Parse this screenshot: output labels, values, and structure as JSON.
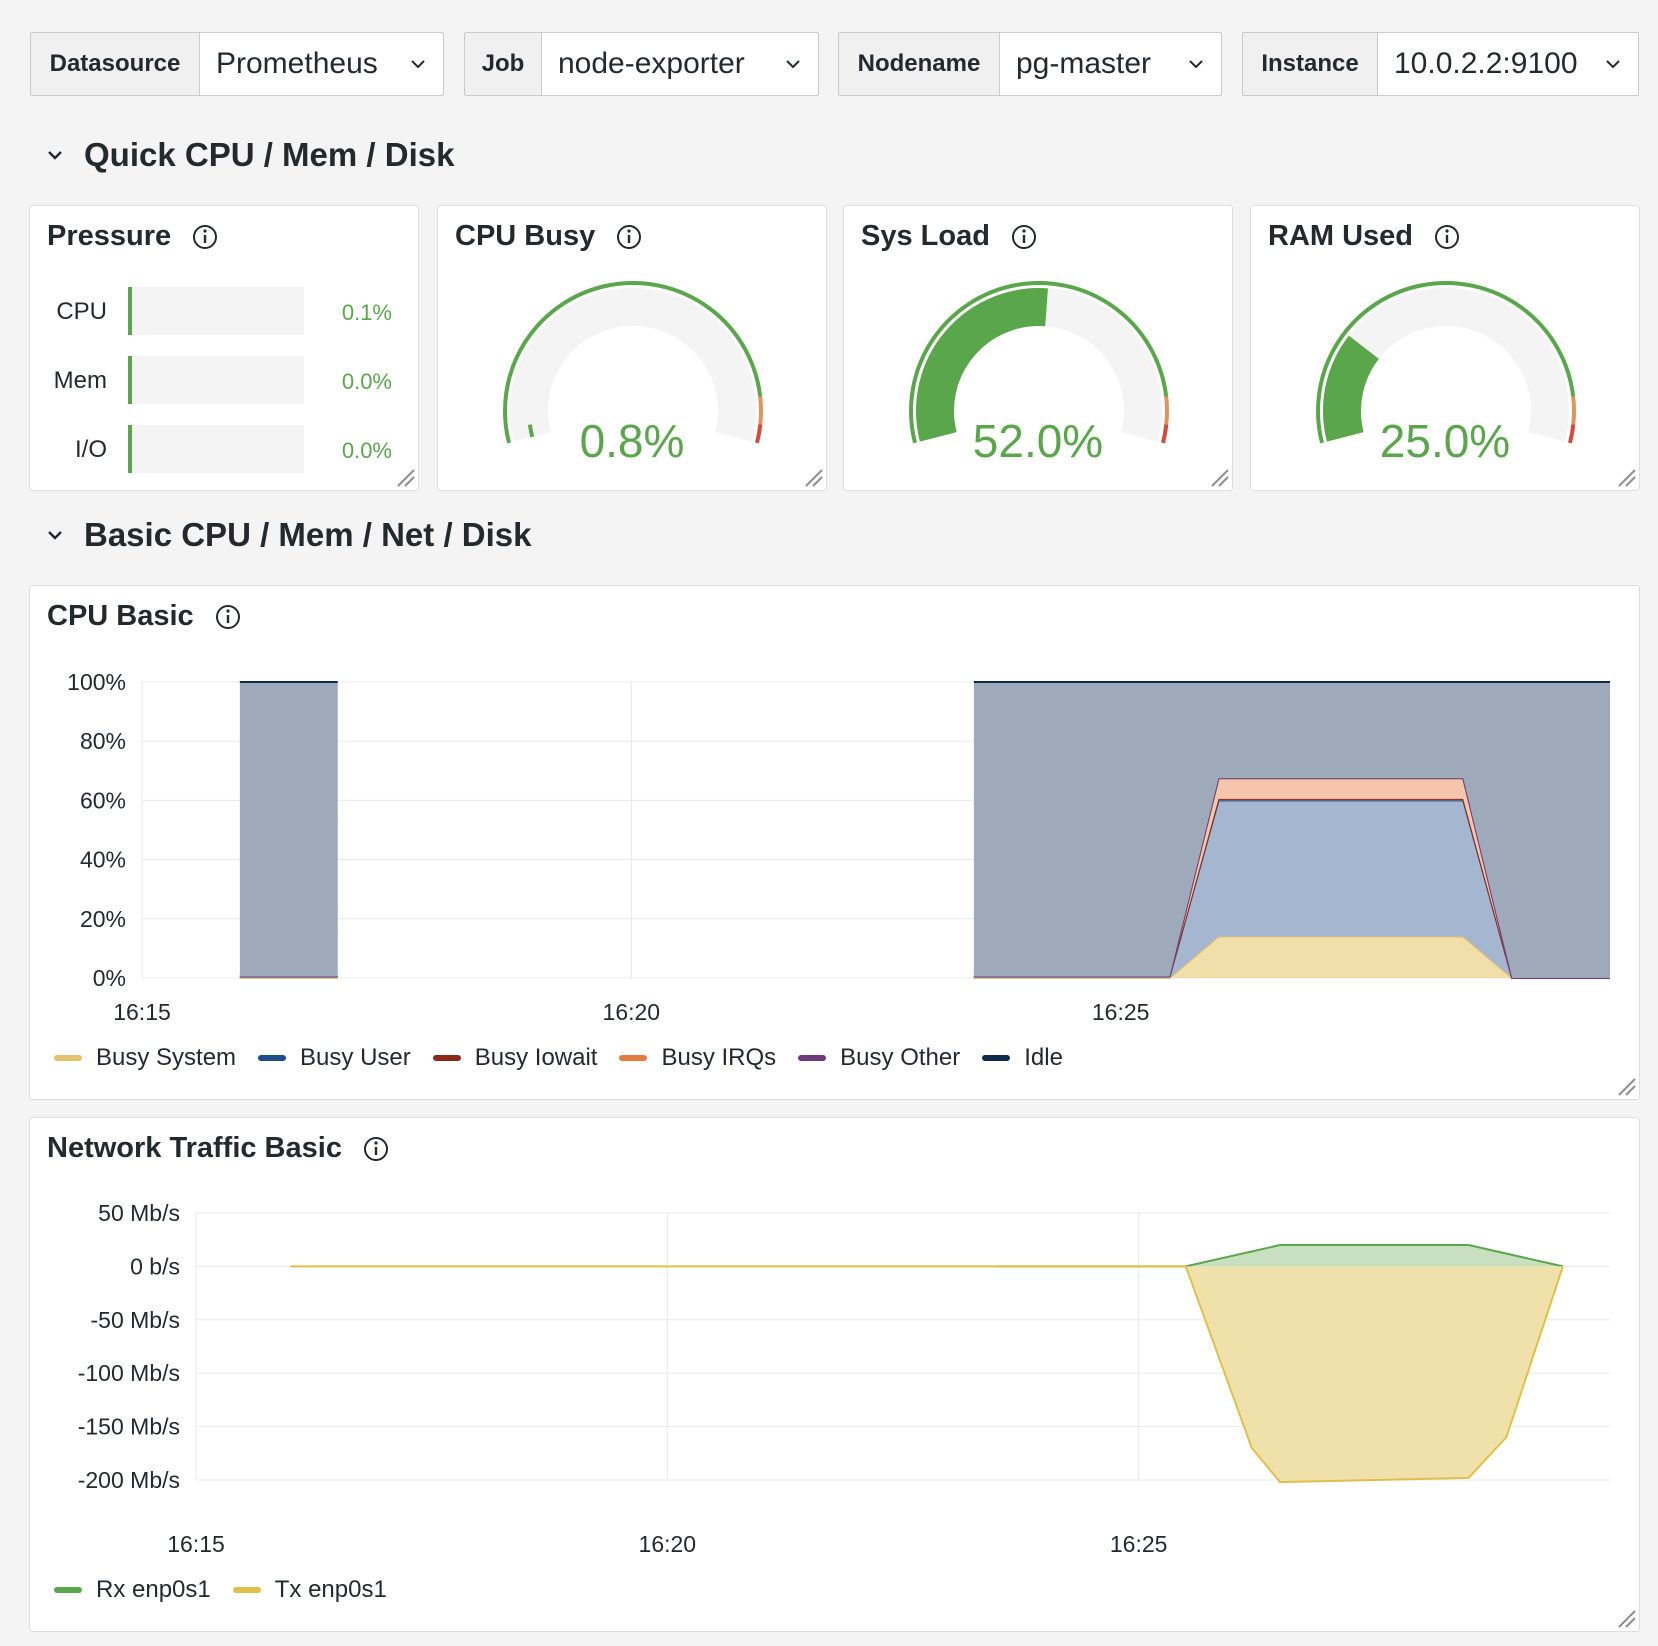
{
  "variables": [
    {
      "label": "Datasource",
      "value": "Prometheus"
    },
    {
      "label": "Job",
      "value": "node-exporter"
    },
    {
      "label": "Nodename",
      "value": "pg-master"
    },
    {
      "label": "Instance",
      "value": "10.0.2.2:9100"
    }
  ],
  "rows": {
    "quick": {
      "title": "Quick CPU / Mem / Disk"
    },
    "basic": {
      "title": "Basic CPU / Mem / Net / Disk"
    }
  },
  "pressure": {
    "title": "Pressure",
    "items": [
      {
        "label": "CPU",
        "value": "0.1%",
        "fraction": 0.001
      },
      {
        "label": "Mem",
        "value": "0.0%",
        "fraction": 0.0
      },
      {
        "label": "I/O",
        "value": "0.0%",
        "fraction": 0.0
      }
    ]
  },
  "gauges": [
    {
      "title": "CPU Busy",
      "value": "0.8%",
      "percent": 0.8
    },
    {
      "title": "Sys Load",
      "value": "52.0%",
      "percent": 52.0
    },
    {
      "title": "RAM Used",
      "value": "25.0%",
      "percent": 25.0
    }
  ],
  "colors": {
    "green": "#5aa64b",
    "orange": "#e0935a",
    "red": "#d44a3a",
    "track": "#f4f4f4"
  },
  "chart_data": [
    {
      "type": "area",
      "title": "CPU Basic",
      "x_ticks": [
        "16:15",
        "16:20",
        "16:25"
      ],
      "y_ticks": [
        "100%",
        "80%",
        "60%",
        "40%",
        "20%",
        "0%"
      ],
      "ylim": [
        0,
        100
      ],
      "xlim_minutes": [
        0,
        15
      ],
      "stacked": true,
      "series": [
        {
          "name": "Busy System",
          "color": "#e3c16f",
          "points": [
            [
              1.0,
              0
            ],
            [
              2.0,
              0
            ],
            [
              8.5,
              0
            ],
            [
              10.5,
              0
            ],
            [
              11.0,
              14
            ],
            [
              13.5,
              14
            ],
            [
              14.0,
              0
            ],
            [
              15.0,
              0
            ]
          ]
        },
        {
          "name": "Busy User",
          "color": "#1f4e8c",
          "points": [
            [
              1.0,
              0.5
            ],
            [
              2.0,
              0.5
            ],
            [
              8.5,
              0.5
            ],
            [
              10.5,
              0.5
            ],
            [
              11.0,
              46
            ],
            [
              13.5,
              46
            ],
            [
              14.0,
              0
            ],
            [
              15.0,
              0
            ]
          ]
        },
        {
          "name": "Busy Iowait",
          "color": "#8b2a1b",
          "points": [
            [
              1.0,
              0
            ],
            [
              2.0,
              0
            ],
            [
              8.5,
              0
            ],
            [
              10.5,
              0
            ],
            [
              11.0,
              0.5
            ],
            [
              13.5,
              0.5
            ],
            [
              14.0,
              0
            ],
            [
              15.0,
              0
            ]
          ]
        },
        {
          "name": "Busy IRQs",
          "color": "#e57c3e",
          "points": [
            [
              1.0,
              0
            ],
            [
              2.0,
              0
            ],
            [
              8.5,
              0
            ],
            [
              10.5,
              0
            ],
            [
              11.0,
              7
            ],
            [
              13.5,
              7
            ],
            [
              14.0,
              0
            ],
            [
              15.0,
              0
            ]
          ]
        },
        {
          "name": "Busy Other",
          "color": "#6e3a7a",
          "points": [
            [
              1.0,
              0
            ],
            [
              2.0,
              0
            ],
            [
              8.5,
              0
            ],
            [
              10.5,
              0
            ],
            [
              11.0,
              0
            ],
            [
              13.5,
              0
            ],
            [
              14.0,
              0
            ],
            [
              15.0,
              0
            ]
          ]
        },
        {
          "name": "Idle",
          "color": "#102a4a",
          "points": [
            [
              1.0,
              99.5
            ],
            [
              2.0,
              99.5
            ],
            [
              8.5,
              99.5
            ],
            [
              10.5,
              99.5
            ],
            [
              11.0,
              32.5
            ],
            [
              13.5,
              32.5
            ],
            [
              14.0,
              100
            ],
            [
              15.0,
              100
            ]
          ]
        }
      ]
    },
    {
      "type": "area",
      "title": "Network Traffic Basic",
      "x_ticks": [
        "16:15",
        "16:20",
        "16:25"
      ],
      "y_ticks": [
        "50 Mb/s",
        "0 b/s",
        "-50 Mb/s",
        "-100 Mb/s",
        "-150 Mb/s",
        "-200 Mb/s"
      ],
      "ylim": [
        -200,
        50
      ],
      "series": [
        {
          "name": "Rx enp0s1",
          "color": "#5aa64b",
          "points": [
            [
              8.5,
              0
            ],
            [
              10.5,
              0
            ],
            [
              11.5,
              20
            ],
            [
              13.5,
              20
            ],
            [
              14.5,
              0
            ]
          ]
        },
        {
          "name": "Tx enp0s1",
          "color": "#e0c04a",
          "points": [
            [
              1.0,
              0
            ],
            [
              2.0,
              0
            ],
            [
              8.5,
              0
            ],
            [
              10.5,
              0
            ],
            [
              11.2,
              -170
            ],
            [
              11.5,
              -202
            ],
            [
              13.5,
              -198
            ],
            [
              13.9,
              -160
            ],
            [
              14.5,
              0
            ]
          ]
        }
      ]
    }
  ]
}
